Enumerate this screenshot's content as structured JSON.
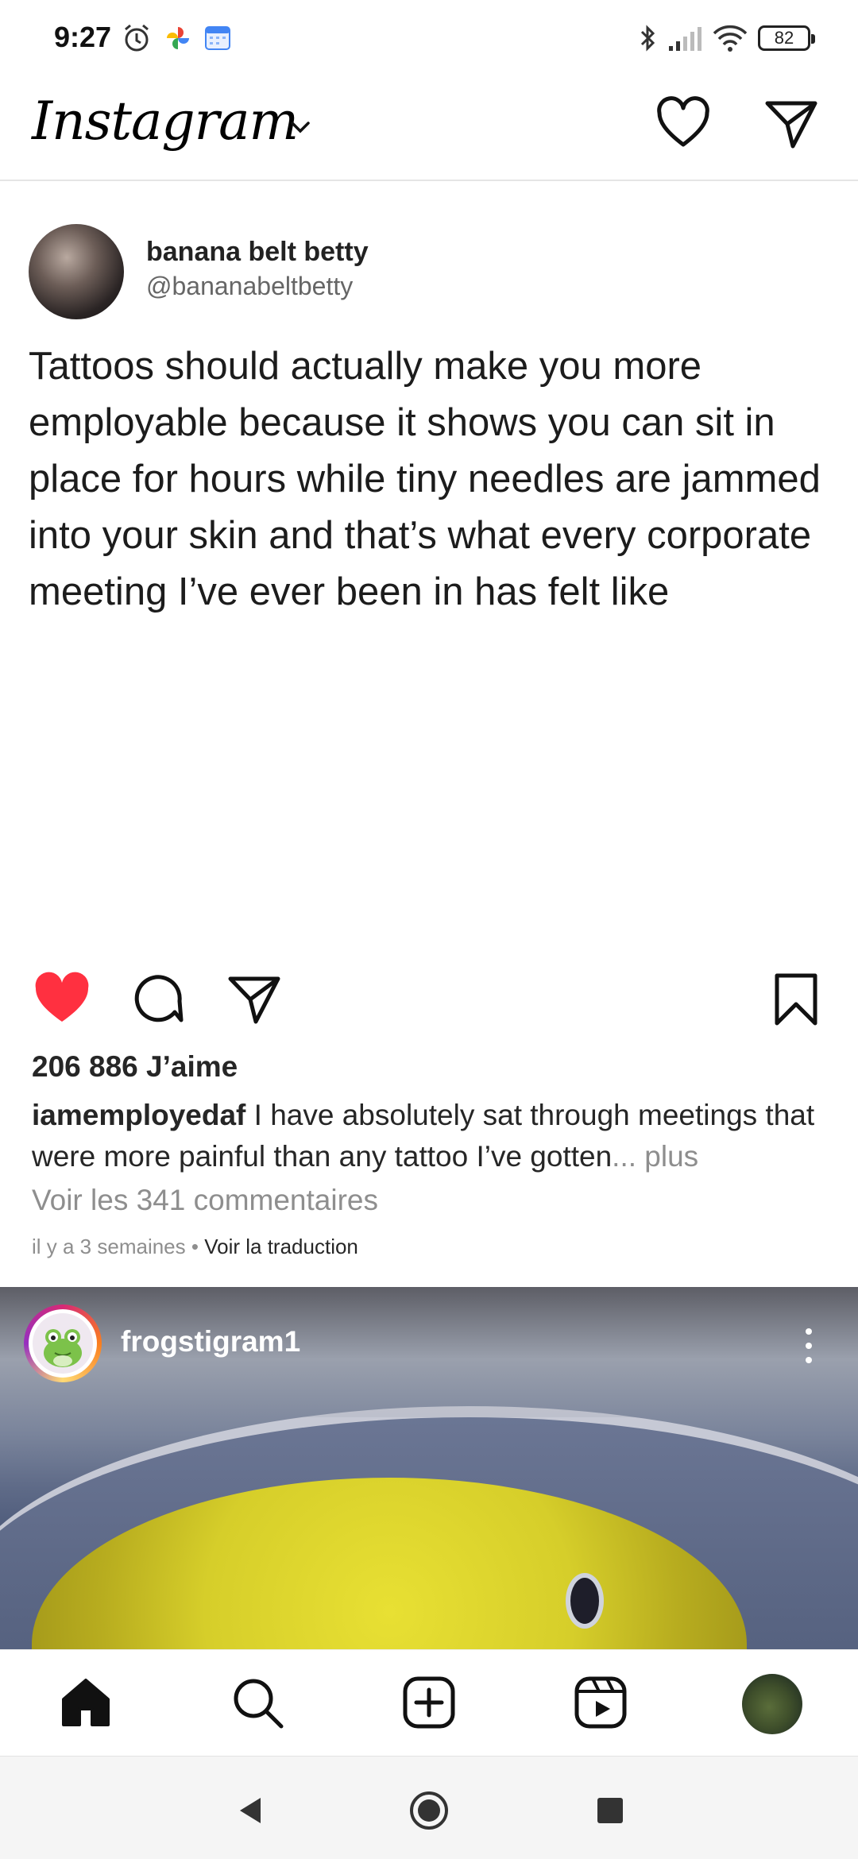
{
  "status_bar": {
    "time": "9:27",
    "battery": "82",
    "icons": [
      "alarm-icon",
      "photos-icon",
      "calendar-icon",
      "bluetooth-icon",
      "signal-icon",
      "wifi-icon",
      "battery-icon"
    ]
  },
  "header": {
    "logo": "Instagram",
    "icons": [
      "chevron-down-icon",
      "heart-icon",
      "direct-message-icon"
    ]
  },
  "post1": {
    "tweet": {
      "name": "banana belt betty",
      "handle": "@bananabeltbetty",
      "text": "Tattoos should actually make you more employable because it shows you can sit in place for hours while tiny needles are jammed into your skin and that’s what every corporate meeting I’ve ever been in has felt like"
    },
    "likes": "206 886 J’aime",
    "caption_user": "iamemployedaf",
    "caption_text": " I have absolutely sat through meetings that were more painful than any tattoo I’ve gotten",
    "caption_more": "... plus",
    "view_comments": "Voir les 341 commentaires",
    "time_ago": "il y a 3 semaines",
    "separator": " • ",
    "translate": "Voir la traduction",
    "colors": {
      "liked_heart": "#ff3040"
    }
  },
  "post2": {
    "username": "frogstigram1"
  },
  "tabbar": {
    "tabs": [
      "home-icon",
      "search-icon",
      "create-icon",
      "reels-icon",
      "profile-avatar"
    ]
  },
  "navbar": {
    "buttons": [
      "back-icon",
      "home-circle-icon",
      "recents-icon"
    ]
  }
}
